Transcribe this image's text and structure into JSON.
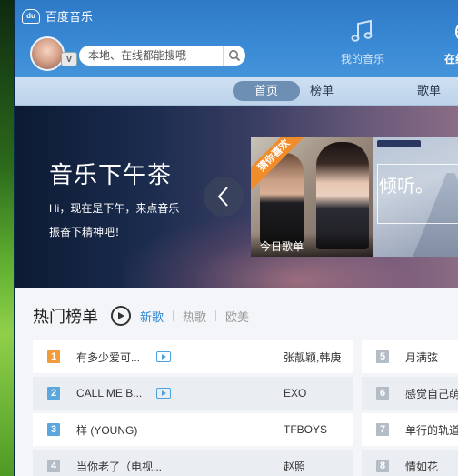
{
  "app": {
    "title": "百度音乐",
    "logo_badge": "du"
  },
  "search": {
    "placeholder": "本地、在线都能搜哦"
  },
  "vip": {
    "label": "V"
  },
  "top_nav": [
    {
      "label": "我的音乐",
      "icon": "music-note-icon"
    },
    {
      "label": "在线音乐",
      "icon": "globe-icon"
    }
  ],
  "sub_nav": {
    "tabs": [
      "首页",
      "榜单",
      "歌单"
    ],
    "active_index": 0
  },
  "banner": {
    "title": "音乐下午茶",
    "line1": "Hi，现在是下午，来点音乐",
    "line2": "振奋下精神吧！",
    "card1": {
      "ribbon": "猜你喜欢",
      "title": "今日歌单"
    },
    "card2": {
      "title": "倾听。"
    }
  },
  "hot_chart": {
    "title": "热门榜单",
    "filters": [
      "新歌",
      "热歌",
      "欧美"
    ],
    "active_filter_index": 0,
    "rows": [
      {
        "rank": "1",
        "song": "有多少爱可...",
        "artist": "张靓颖,韩庚",
        "has_mv": true
      },
      {
        "rank": "2",
        "song": "CALL ME B...",
        "artist": "EXO",
        "has_mv": true
      },
      {
        "rank": "3",
        "song": "样 (YOUNG)",
        "artist": "TFBOYS",
        "has_mv": false
      },
      {
        "rank": "4",
        "song": "当你老了（电视...",
        "artist": "赵照",
        "has_mv": false
      }
    ],
    "right_rows": [
      {
        "rank": "5",
        "song": "月满弦"
      },
      {
        "rank": "6",
        "song": "感觉自己萌"
      },
      {
        "rank": "7",
        "song": "单行的轨道"
      },
      {
        "rank": "8",
        "song": "情如花"
      }
    ]
  },
  "colors": {
    "accent": "#2f8ad6",
    "rank_top": "#f29b3b",
    "rank_mid": "#5aa6dd",
    "rank_low": "#b4bcc6"
  }
}
